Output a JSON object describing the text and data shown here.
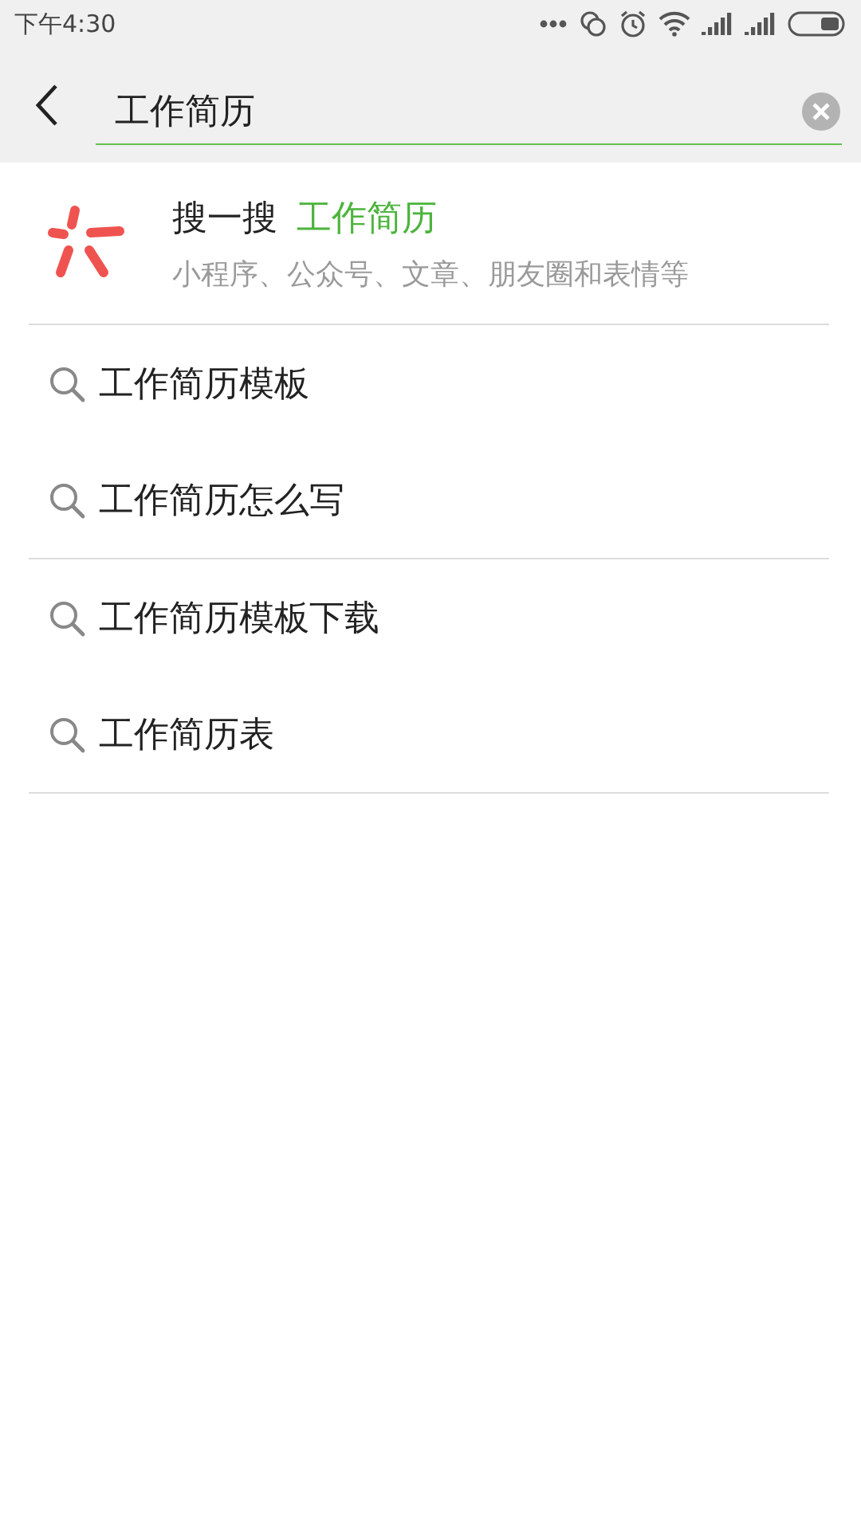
{
  "status_bar": {
    "time": "下午4:30"
  },
  "search": {
    "value": "工作简历"
  },
  "souyisou": {
    "label": "搜一搜",
    "query": "工作简历",
    "subtitle": "小程序、公众号、文章、朋友圈和表情等"
  },
  "suggestion_groups": [
    [
      "工作简历模板",
      "工作简历怎么写"
    ],
    [
      "工作简历模板下载",
      "工作简历表"
    ]
  ]
}
